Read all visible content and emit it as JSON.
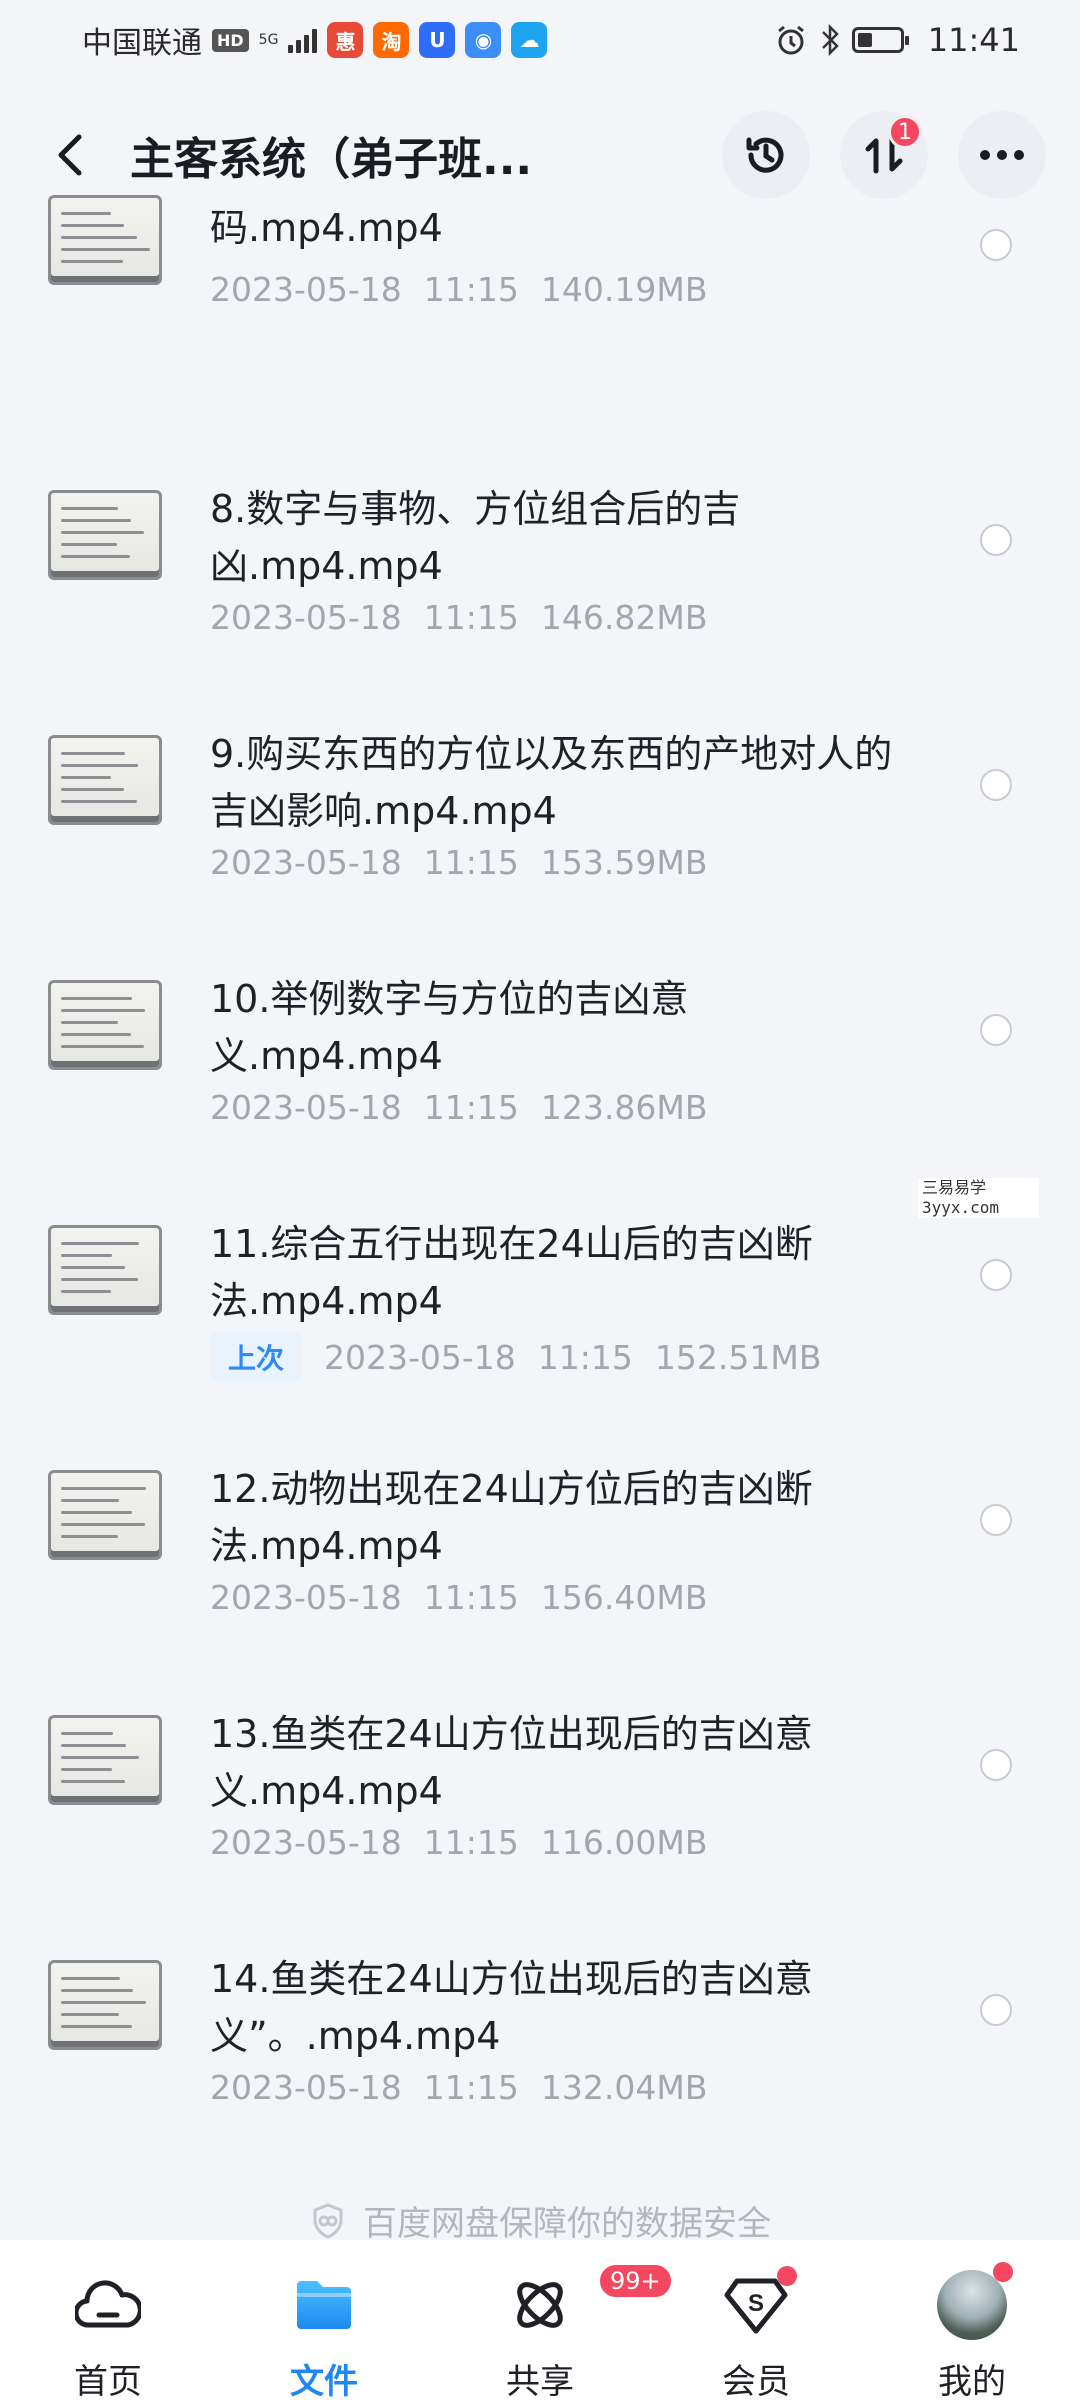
{
  "status_bar": {
    "carrier": "中国联通",
    "hd": "HD",
    "network": "5G",
    "time": "11:41",
    "app_icons": [
      {
        "name": "app-icon",
        "color": "#e84a3a",
        "glyph": "惠"
      },
      {
        "name": "taobao-icon",
        "color": "#ff6a00",
        "glyph": "淘"
      },
      {
        "name": "app-icon",
        "color": "#2f6df6",
        "glyph": "U"
      },
      {
        "name": "app-icon",
        "color": "#3a8ef6",
        "glyph": "◉"
      },
      {
        "name": "weather-icon",
        "color": "#1ea4f0",
        "glyph": "☁"
      }
    ]
  },
  "header": {
    "title": "主客系统（弟子班...",
    "transfer_badge": "1"
  },
  "files": [
    {
      "name": "码.mp4.mp4",
      "date": "2023-05-18",
      "time": "11:15",
      "size": "140.19MB",
      "tag": ""
    },
    {
      "name": "8.数字与事物、方位组合后的吉凶.mp4.mp4",
      "date": "2023-05-18",
      "time": "11:15",
      "size": "146.82MB",
      "tag": ""
    },
    {
      "name": "9.购买东西的方位以及东西的产地对人的吉凶影响.mp4.mp4",
      "date": "2023-05-18",
      "time": "11:15",
      "size": "153.59MB",
      "tag": ""
    },
    {
      "name": "10.举例数字与方位的吉凶意义.mp4.mp4",
      "date": "2023-05-18",
      "time": "11:15",
      "size": "123.86MB",
      "tag": ""
    },
    {
      "name": "11.综合五行出现在24山后的吉凶断法.mp4.mp4",
      "date": "2023-05-18",
      "time": "11:15",
      "size": "152.51MB",
      "tag": "上次"
    },
    {
      "name": "12.动物出现在24山方位后的吉凶断法.mp4.mp4",
      "date": "2023-05-18",
      "time": "11:15",
      "size": "156.40MB",
      "tag": ""
    },
    {
      "name": "13.鱼类在24山方位出现后的吉凶意义.mp4.mp4",
      "date": "2023-05-18",
      "time": "11:15",
      "size": "116.00MB",
      "tag": ""
    },
    {
      "name": "14.鱼类在24山方位出现后的吉凶意义”。.mp4.mp4",
      "date": "2023-05-18",
      "time": "11:15",
      "size": "132.04MB",
      "tag": ""
    }
  ],
  "watermark": {
    "line1": "三易易学",
    "line2": "3yyx.com"
  },
  "safety_text": "百度网盘保障你的数据安全",
  "bottom_nav": {
    "items": [
      {
        "label": "首页",
        "icon": "cloud-home-icon",
        "active": false
      },
      {
        "label": "文件",
        "icon": "folder-icon",
        "active": true
      },
      {
        "label": "共享",
        "icon": "share-planet-icon",
        "active": false,
        "badge": "99+"
      },
      {
        "label": "会员",
        "icon": "vip-icon",
        "active": false
      },
      {
        "label": "我的",
        "icon": "avatar",
        "active": false
      }
    ]
  },
  "colors": {
    "accent": "#1e88f0",
    "badge": "#f5475f",
    "background": "#f4f5f9"
  }
}
